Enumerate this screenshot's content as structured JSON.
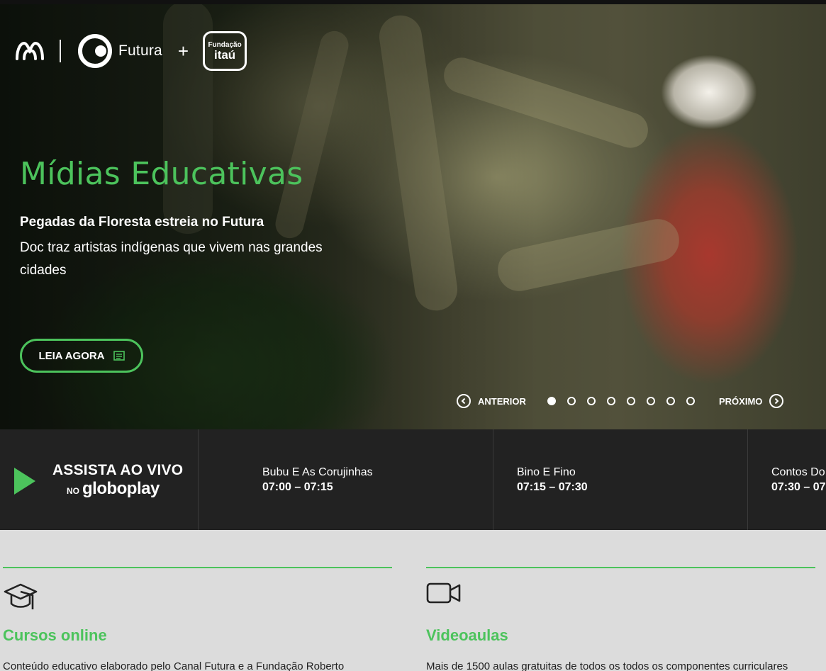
{
  "brand": {
    "futura_label": "Futura",
    "plus": "+",
    "itau_line1": "Fundação",
    "itau_line2": "itaú"
  },
  "hero": {
    "title": "Mídias Educativas",
    "subtitle": "Pegadas da Floresta estreia no Futura",
    "description": "Doc traz artistas indígenas que vivem nas grandes cidades",
    "cta_label": "LEIA AGORA",
    "prev_label": "ANTERIOR",
    "next_label": "PRÓXIMO",
    "slide_count": 8,
    "active_slide": 1
  },
  "live": {
    "label": "ASSISTA AO VIVO",
    "sub_prefix": "NO",
    "sub_brand": "globoplay",
    "programs": [
      {
        "name": "Bubu E As Corujinhas",
        "time": "07:00 – 07:15"
      },
      {
        "name": "Bino E Fino",
        "time": "07:15 – 07:30"
      },
      {
        "name": "Contos Do",
        "time": "07:30 – 07"
      }
    ]
  },
  "cards": [
    {
      "title": "Cursos online",
      "text": "Conteúdo educativo elaborado pelo Canal Futura e a Fundação Roberto",
      "icon": "graduation-cap-icon"
    },
    {
      "title": "Videoaulas",
      "text": "Mais de 1500 aulas gratuitas de todos os todos os componentes curriculares",
      "icon": "video-camera-icon"
    }
  ],
  "colors": {
    "accent": "#4cc35c",
    "dark_strip": "#222222",
    "page_bg": "#dcdcdc"
  }
}
